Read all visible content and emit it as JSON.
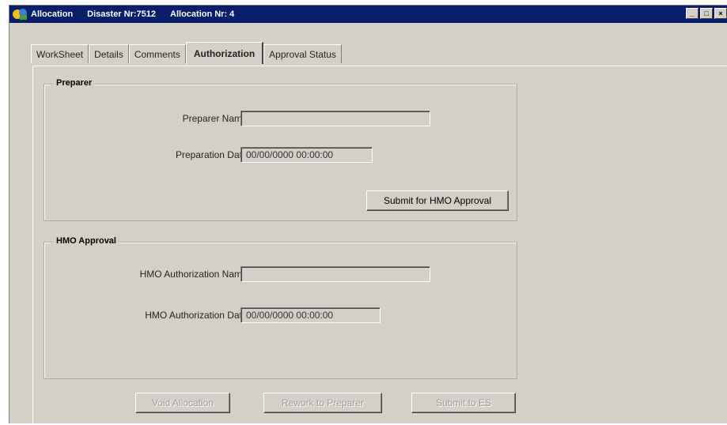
{
  "titlebar": {
    "app": "Allocation",
    "disaster": "Disaster Nr:7512",
    "allocation": "Allocation Nr: 4"
  },
  "tabs": [
    "WorkSheet",
    "Details",
    "Comments",
    "Authorization",
    "Approval Status"
  ],
  "active_tab": "Authorization",
  "preparer": {
    "legend": "Preparer",
    "name_label": "Preparer Name:",
    "name_value": "",
    "date_label": "Preparation Date:",
    "date_value": "00/00/0000  00:00:00",
    "submit_label": "Submit for HMO Approval"
  },
  "hmo": {
    "legend": "HMO Approval",
    "name_label": "HMO Authorization Name:",
    "name_value": "",
    "date_label": "HMO Authorization Date:",
    "date_value": "00/00/0000 00:00:00"
  },
  "footer": {
    "void_label": "Void Allocation",
    "rework_label": "Rework to Preparer",
    "submit_es_label": "Submit to ES"
  },
  "colors": {
    "titlebar": "#0a1f6b",
    "window": "#d4d0c8"
  }
}
